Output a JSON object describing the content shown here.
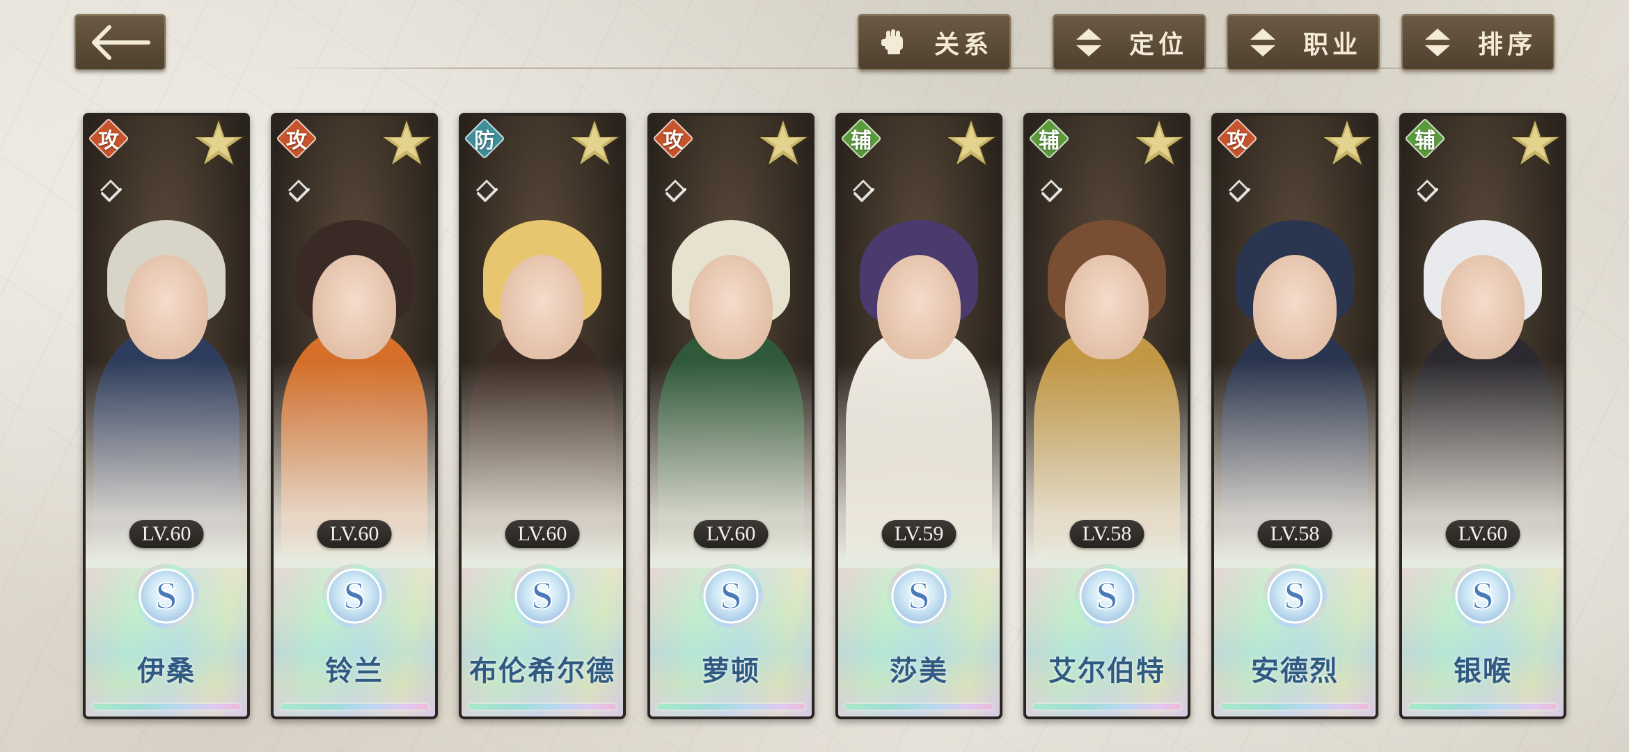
{
  "top_bar": {
    "back_icon": "arrow-left-icon",
    "filters": [
      {
        "id": "relation",
        "label": "关系",
        "icon": "fist-icon"
      },
      {
        "id": "position",
        "label": "定位",
        "icon": "sort-arrows-icon"
      },
      {
        "id": "class",
        "label": "职业",
        "icon": "sort-arrows-icon"
      },
      {
        "id": "sort",
        "label": "排序",
        "icon": "sort-arrows-icon"
      }
    ]
  },
  "colors": {
    "attack": "#c5532c",
    "defense": "#3f8f9a",
    "support": "#5a9a3a",
    "name_text": "#2f5a82"
  },
  "characters": [
    {
      "role": "攻",
      "role_type": "attack",
      "level": "LV.60",
      "rarity": "S",
      "name": "伊桑",
      "hair": "#d9d4c8",
      "outfit": "#2e3d5e"
    },
    {
      "role": "攻",
      "role_type": "attack",
      "level": "LV.60",
      "rarity": "S",
      "name": "铃兰",
      "hair": "#3a2a26",
      "outfit": "#d8702a"
    },
    {
      "role": "防",
      "role_type": "defense",
      "level": "LV.60",
      "rarity": "S",
      "name": "布伦希尔德",
      "hair": "#e8c670",
      "outfit": "#3a2a24"
    },
    {
      "role": "攻",
      "role_type": "attack",
      "level": "LV.60",
      "rarity": "S",
      "name": "萝顿",
      "hair": "#e6e2cf",
      "outfit": "#2f5a3a"
    },
    {
      "role": "辅",
      "role_type": "support",
      "level": "LV.59",
      "rarity": "S",
      "name": "莎美",
      "hair": "#4a3a6e",
      "outfit": "#f1ede4"
    },
    {
      "role": "辅",
      "role_type": "support",
      "level": "LV.58",
      "rarity": "S",
      "name": "艾尔伯特",
      "hair": "#7a4e32",
      "outfit": "#c59a45"
    },
    {
      "role": "攻",
      "role_type": "attack",
      "level": "LV.58",
      "rarity": "S",
      "name": "安德烈",
      "hair": "#2a3550",
      "outfit": "#2a3550"
    },
    {
      "role": "辅",
      "role_type": "support",
      "level": "LV.60",
      "rarity": "S",
      "name": "银喉",
      "hair": "#e8eaee",
      "outfit": "#2c2a30"
    }
  ]
}
